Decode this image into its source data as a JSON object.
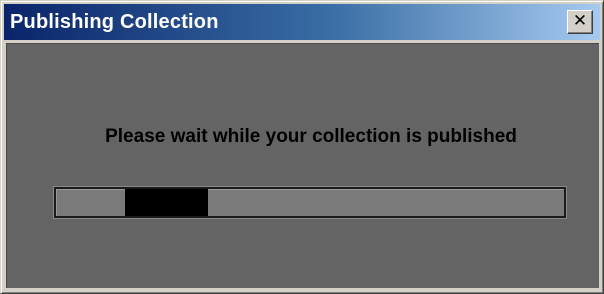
{
  "window": {
    "title": "Publishing Collection",
    "close_icon_name": "close-icon",
    "close_glyph": "✕"
  },
  "body": {
    "message": "Please wait while your collection is published"
  },
  "progress": {
    "mode": "indeterminate",
    "chunk_start_fraction": 0.136,
    "chunk_end_fraction": 0.3,
    "chunk_color": "#000000"
  },
  "colors": {
    "title_gradient_start": "#0a246a",
    "title_gradient_end": "#a6caf0",
    "client_background": "#646464",
    "frame": "#d4d0c8"
  }
}
